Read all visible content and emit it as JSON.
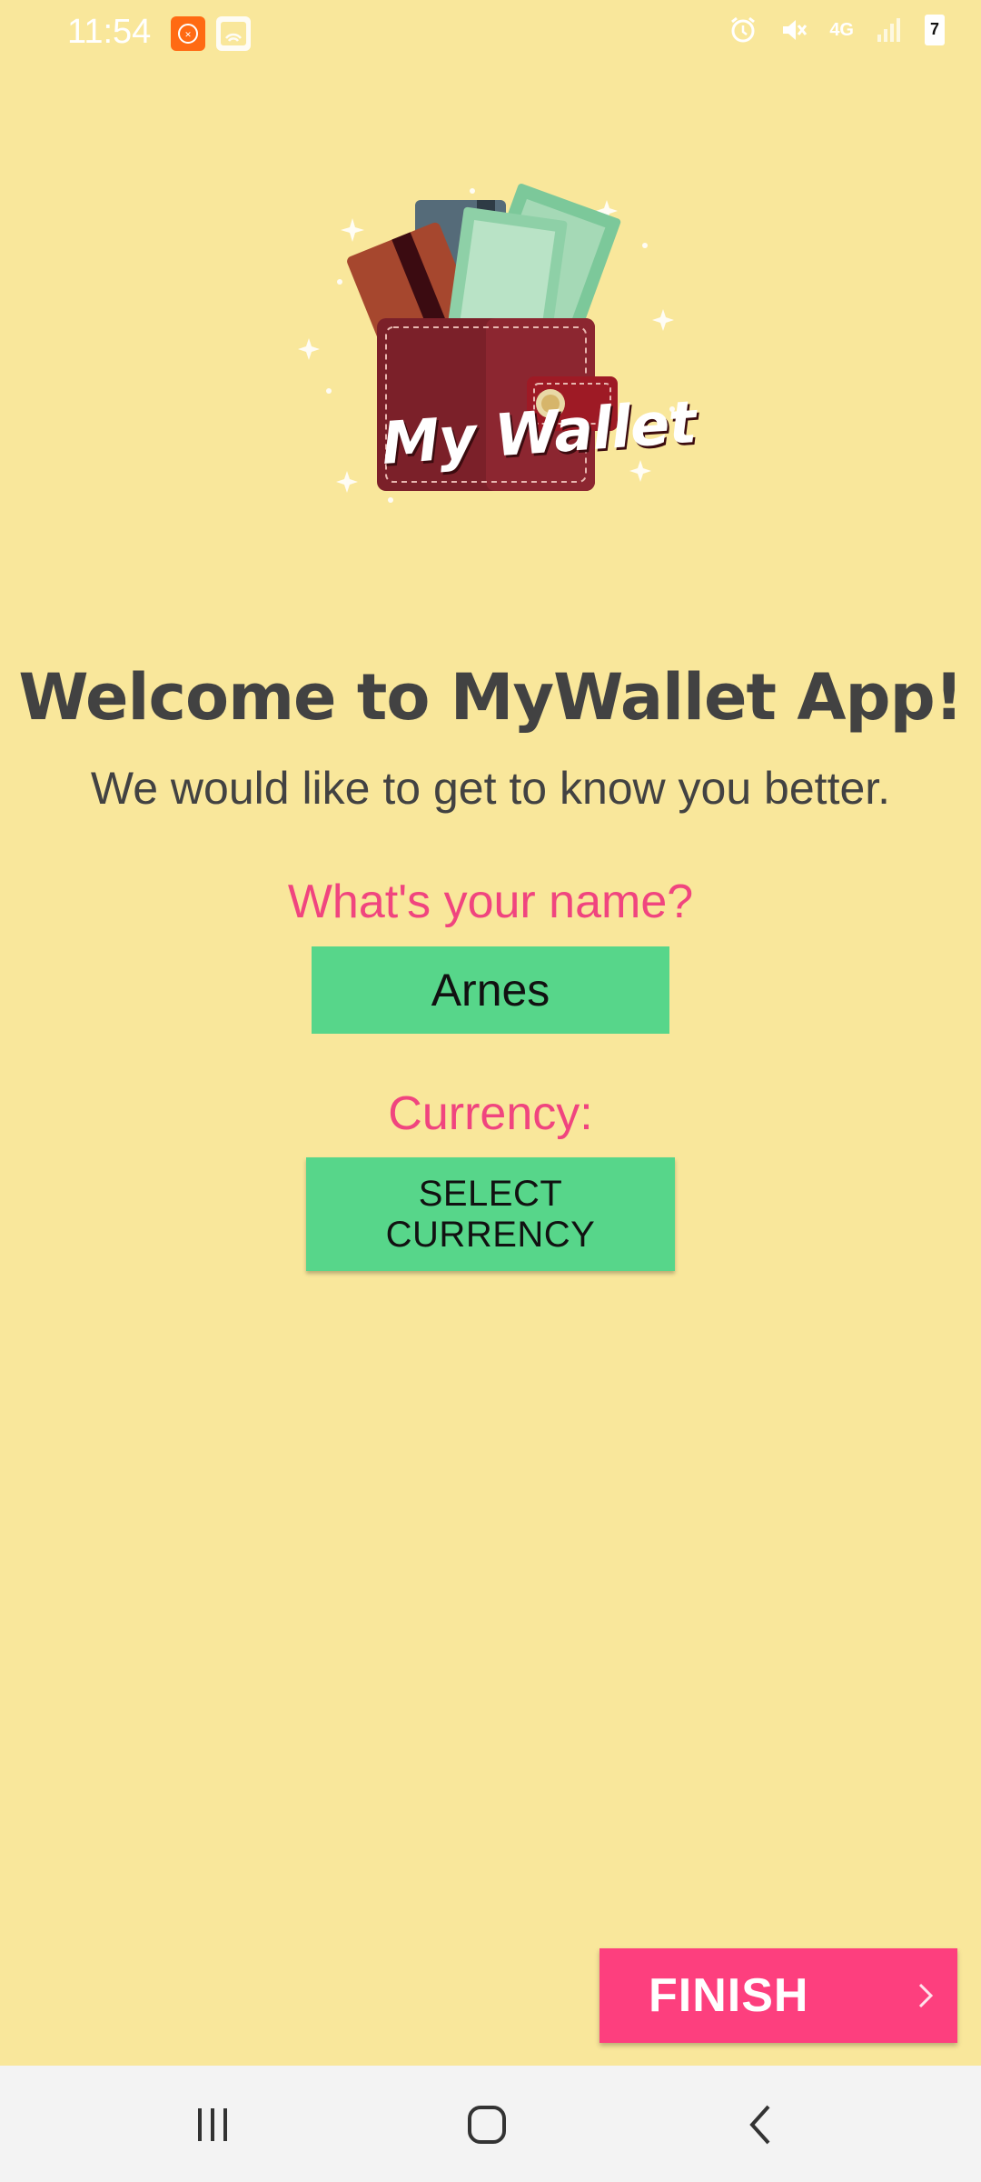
{
  "status_bar": {
    "time": "11:54",
    "network_label": "4G",
    "battery_level": "7"
  },
  "logo": {
    "text": "My Wallet"
  },
  "welcome": {
    "title": "Welcome to MyWallet App!",
    "subtitle": "We would like to get to know you better."
  },
  "form": {
    "name_label": "What's your name?",
    "name_value": "Arnes",
    "currency_label": "Currency:",
    "currency_button": "SELECT CURRENCY"
  },
  "actions": {
    "finish_label": "FINISH"
  },
  "nav": {
    "icons": [
      "recent-apps-icon",
      "home-icon",
      "back-icon"
    ]
  },
  "colors": {
    "background": "#F9E79B",
    "accent_pink": "#F0457F",
    "button_green": "#57D68A",
    "finish_pink": "#FD3F7E"
  }
}
